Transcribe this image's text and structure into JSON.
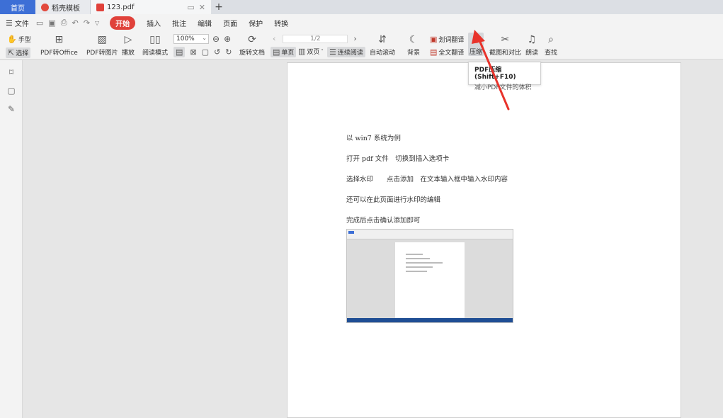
{
  "tabs": {
    "home": "首页",
    "templates": "稻壳模板",
    "document": "123.pdf",
    "new_tab": "+"
  },
  "menubar": {
    "file_label": "文件",
    "items": [
      "开始",
      "插入",
      "批注",
      "编辑",
      "页面",
      "保护",
      "转换"
    ]
  },
  "toolbar": {
    "hand": "手型",
    "select": "选择",
    "pdf_to_office": "PDF转Office",
    "pdf_to_image": "PDF转图片",
    "play": "播放",
    "read_mode": "阅读模式",
    "zoom": "100%",
    "rotate": "旋转文档",
    "page_indicator": "1/2",
    "single_page": "单页",
    "double_page": "双页",
    "continuous_read": "连续阅读",
    "auto_scroll": "自动滚动",
    "background": "背景",
    "word_translate": "划词翻译",
    "full_translate": "全文翻译",
    "compress": "压缩",
    "screenshot_compare": "截图和对比",
    "read_aloud": "朗读",
    "find": "查找"
  },
  "tooltip": {
    "title": "PDF压缩 (Shift+F10)",
    "description": "减小PDF文件的体积"
  },
  "document": {
    "lines": [
      "以 win7 系统为例",
      "打开 pdf 文件　切换到插入选项卡",
      "选择水印　　点击添加　在文本输入框中输入水印内容",
      "还可以在此页面进行水印的编辑",
      "完成后点击确认添加即可"
    ]
  },
  "colors": {
    "accent_blue": "#3d6fd6",
    "active_red": "#e0413a",
    "arrow_red": "#e8332b"
  }
}
